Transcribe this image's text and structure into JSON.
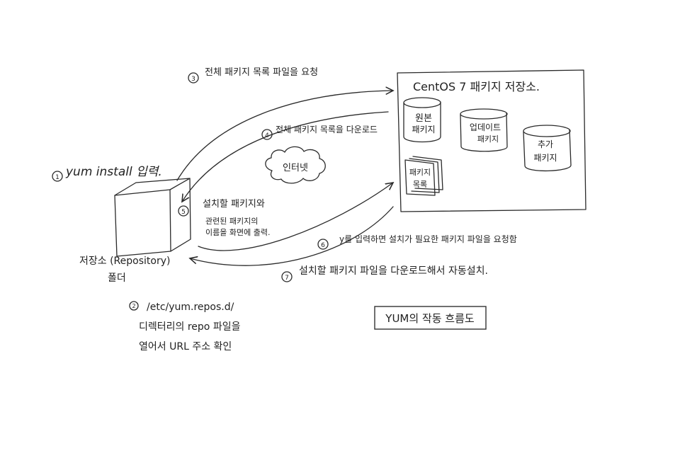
{
  "step1": {
    "num": "1",
    "text": "yum install 입력."
  },
  "step2": {
    "num": "2",
    "lines": [
      "/etc/yum.repos.d/",
      "디렉터리의 repo 파일을",
      "열어서 URL 주소 확인"
    ]
  },
  "step3": {
    "num": "3",
    "text": "전체 패키지 목록 파일을 요청"
  },
  "step4": {
    "num": "4",
    "text": "전체 패키지 목록을 다운로드"
  },
  "step5": {
    "num": "5",
    "lines": [
      "설치할 패키지와",
      "관련된 패키지의",
      "이름을 화면에 출력."
    ]
  },
  "step6": {
    "num": "6",
    "text": "y를 입력하면 설치가 필요한 패키지 파일을 요청함"
  },
  "step7": {
    "num": "7",
    "text": "설치할 패키지 파일을 다운로드해서 자동설치."
  },
  "repo_folder": {
    "lines": [
      "저장소 (Repository)",
      "폴더"
    ]
  },
  "internet": "인터넷",
  "centos_repo": {
    "title": "CentOS 7 패키지 저장소.",
    "original": [
      "원본",
      "패키지"
    ],
    "update": [
      "업데이트",
      "패키지"
    ],
    "extra": [
      "추가",
      "패키지"
    ],
    "list": [
      "패키지",
      "목록"
    ]
  },
  "caption": "YUM의 작동 흐름도"
}
